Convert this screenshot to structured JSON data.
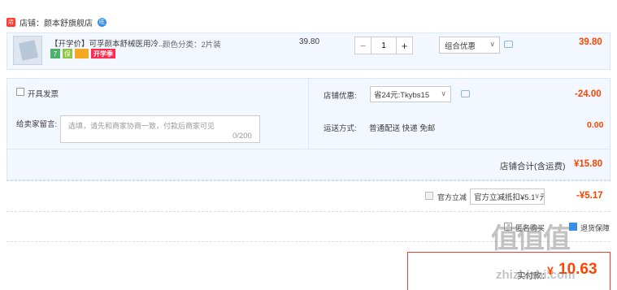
{
  "shop": {
    "logo_text": "店",
    "name": "店铺：颜本舒旗舰店",
    "chat_icon": "wangwang-icon",
    "chat_badge": "旺"
  },
  "item": {
    "title": "【开学价】可孚颜本舒械医用冷...",
    "spec": "颜色分类：2片装",
    "badge_1": "7",
    "badge_2": "保",
    "badge_3_icon": "card-icon",
    "promo_badge": "开学季",
    "unit_price": "39.80",
    "quantity": "1",
    "minus_label": "−",
    "plus_label": "+",
    "combo_label": "组合优惠",
    "total": "39.80"
  },
  "invoice": {
    "label": "开具发票"
  },
  "memo": {
    "label": "给卖家留言:",
    "placeholder": "选填，请先和商家协商一致，付款后商家可见",
    "count": "0/200"
  },
  "coupon": {
    "label": "店铺优惠:",
    "selected": "省24元:Tkybs15",
    "amount": "-24.00"
  },
  "shipping": {
    "label": "运送方式:",
    "value": "普通配送 快递 免邮",
    "amount": "0.00"
  },
  "subtotal": {
    "label": "店铺合计(含运费)",
    "amount": "¥15.80"
  },
  "official_discount": {
    "label": "官方立减",
    "selected": "官方立减抵扣¥5.17元",
    "amount": "-¥5.17"
  },
  "options": {
    "anonymous_label": "匿名购买",
    "fast_label": "退货保障"
  },
  "payment": {
    "label": "实付款：",
    "currency": "¥",
    "amount": "10.63"
  },
  "watermark": {
    "logo": "值值值",
    "url": "zhizhizhi.com"
  },
  "colors": {
    "accent": "#ff4400",
    "panel_bg": "#f3f7ff",
    "panel_border": "#d9e6fb",
    "promo_red": "#ff2b4f"
  }
}
